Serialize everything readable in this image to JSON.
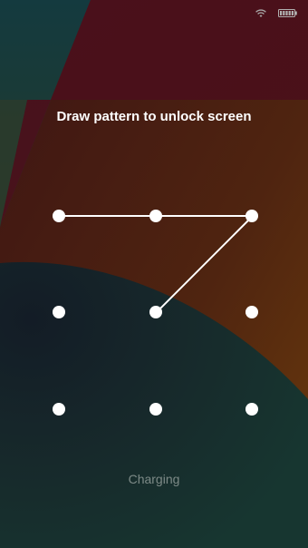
{
  "lock_screen": {
    "instruction": "Draw pattern to unlock screen",
    "status": "Charging"
  },
  "status_bar": {
    "icons": [
      "wifi-icon",
      "battery-icon"
    ]
  },
  "pattern": {
    "selected_sequence": [
      1,
      2,
      3,
      5
    ]
  },
  "colors": {
    "dot": "#ffffff",
    "text": "#ffffff",
    "status_text": "#7d8a87",
    "wallpaper_red": "#4a0f1b",
    "wallpaper_orange": "#5a2e10",
    "wallpaper_teal": "#14322f"
  }
}
